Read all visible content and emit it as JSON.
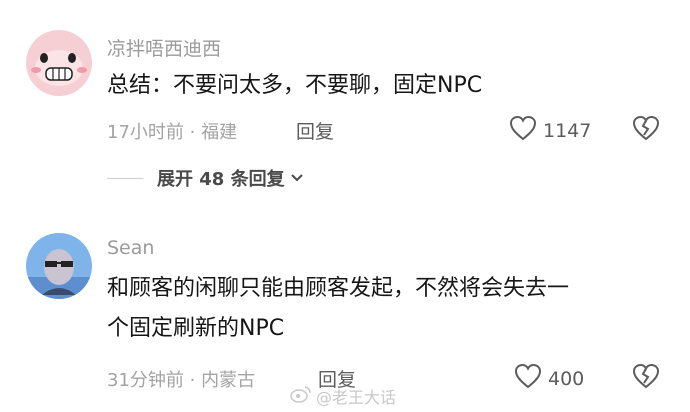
{
  "comments": [
    {
      "username": "凉拌唔西迪西",
      "text_lines": [
        "总结：不要问太多，不要聊，固定NPC"
      ],
      "meta": "17小时前 · 福建",
      "reply_label": "回复",
      "likes": "1147",
      "expand_label": "展开 48 条回复"
    },
    {
      "username": "Sean",
      "text_lines": [
        "和顾客的闲聊只能由顾客发起，不然将会失去一",
        "个固定刷新的NPC"
      ],
      "meta": "31分钟前 · 内蒙古",
      "reply_label": "回复",
      "likes": "400"
    }
  ],
  "watermark": "@老王大话",
  "colors": {
    "meta": "#a3a3a3",
    "text": "#161616",
    "action": "#5c5c5c"
  }
}
